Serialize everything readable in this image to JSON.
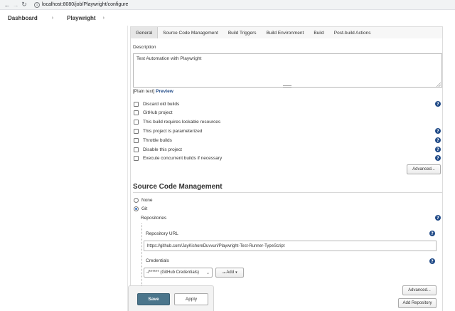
{
  "browser": {
    "url": "localhost:8080/job/Playwright/configure"
  },
  "breadcrumb": {
    "items": [
      "Dashboard",
      "Playwright"
    ]
  },
  "tabs": [
    "General",
    "Source Code Management",
    "Build Triggers",
    "Build Environment",
    "Build",
    "Post-build Actions"
  ],
  "general": {
    "description_label": "Description",
    "description_value": "Test Automation with Playwright",
    "plain_text": "[Plain text]",
    "preview": "Preview",
    "options": [
      "Discard old builds",
      "GitHub project",
      "This build requires lockable resources",
      "This project is parameterized",
      "Throttle builds",
      "Disable this project",
      "Execute concurrent builds if necessary"
    ],
    "advanced_label": "Advanced..."
  },
  "scm": {
    "title": "Source Code Management",
    "options": [
      "None",
      "Git"
    ],
    "selected": "Git",
    "repositories_label": "Repositories",
    "repo_url_label": "Repository URL",
    "repo_url_value": "https://github.com/JayKishoreDuvvuri/Playwright-Test-Runner-TypeScript",
    "credentials_label": "Credentials",
    "credentials_value": "-/****** (GitHub Credentials)",
    "add_label": "Add",
    "advanced_label": "Advanced...",
    "add_repository_label": "Add Repository"
  },
  "footer": {
    "save_label": "Save",
    "apply_label": "Apply"
  },
  "colors": {
    "primary": "#4b758b",
    "help": "#204a87",
    "link": "#204a87"
  }
}
